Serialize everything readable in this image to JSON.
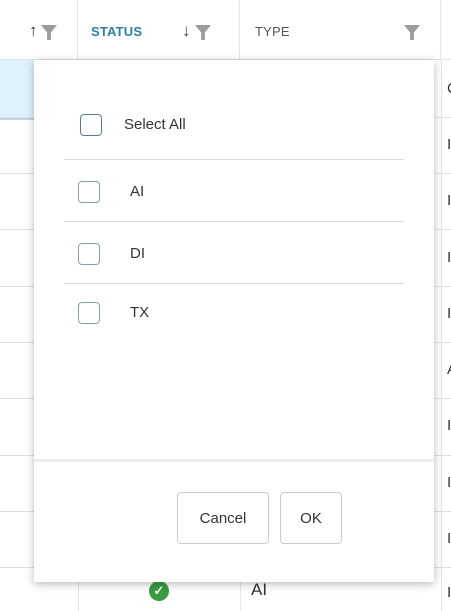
{
  "header": {
    "columns": [
      {
        "label": "",
        "sort": "↑",
        "filter_icon": "filter-funnel-icon"
      },
      {
        "label": "STATUS",
        "sort": "↓",
        "filter_icon": "filter-funnel-icon"
      },
      {
        "label": "TYPE",
        "filter_icon": "filter-funnel-icon"
      }
    ]
  },
  "grid": {
    "edge_letters": [
      "C",
      "I",
      "I",
      "I",
      "I",
      "A",
      "I",
      "I",
      "I",
      "I"
    ],
    "last_row": {
      "status_icon": "check-circle-icon",
      "status_glyph": "✓",
      "type": "AI"
    }
  },
  "filter_popup": {
    "select_all_label": "Select All",
    "options": [
      "AI",
      "DI",
      "TX"
    ],
    "cancel_label": "Cancel",
    "ok_label": "OK"
  },
  "colors": {
    "accent": "#2a7fa8",
    "selected_row": "#dff1fb",
    "status_ok": "#3a9b40"
  }
}
